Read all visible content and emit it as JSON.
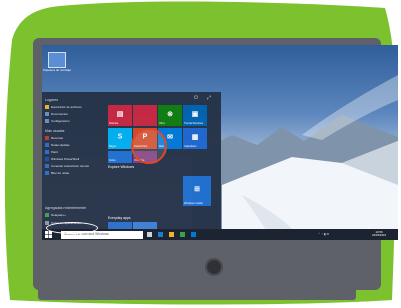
{
  "colors": {
    "blob": "#7cc22f",
    "bezel": "#5e6168",
    "start_menu": "#263348",
    "taskbar": "#1b2430",
    "highlight_ring": "#e34626"
  },
  "desktop": {
    "icon_name": "recycle-bin-icon",
    "icon_label": "Papelera de reciclaje"
  },
  "start_menu": {
    "sections": [
      {
        "heading": "Lugares",
        "items": [
          {
            "label": "Explorador de archivos",
            "icon": "folder-icon",
            "color": "#f0b429"
          },
          {
            "label": "Documentos",
            "icon": "documents-icon",
            "color": "#6b8fbf"
          },
          {
            "label": "Configuración",
            "icon": "gear-icon",
            "color": "#6b8fbf"
          }
        ]
      },
      {
        "heading": "Más usadas",
        "items": [
          {
            "label": "Recortes",
            "icon": "scissors-icon",
            "color": "#c0392b"
          },
          {
            "label": "Notas rápidas",
            "icon": "sticky-notes-icon",
            "color": "#2b6ec9"
          },
          {
            "label": "Paint",
            "icon": "paint-icon",
            "color": "#2b6ec9"
          },
          {
            "label": "Windows PowerShell",
            "icon": "powershell-icon",
            "color": "#1f4e9c"
          },
          {
            "label": "Conectar a Escritorio remoto",
            "icon": "remote-desktop-icon",
            "color": "#2b6ec9"
          },
          {
            "label": "Bloc de notas",
            "icon": "notepad-icon",
            "color": "#2b6ec9"
          }
        ]
      },
      {
        "heading": "Agregadas recientemente",
        "items": [
          {
            "label": "Notepad++",
            "icon": "notepad-plus-icon",
            "color": "#3aa14c"
          }
        ]
      }
    ],
    "all_apps": "Todas las aplicaciones",
    "explore_label": "Explore Windows",
    "everyday_label": "Everyday apps",
    "tiles": [
      {
        "label": "Noticias",
        "icon": "news-icon",
        "color": "#c7273f"
      },
      {
        "label": "Xbox",
        "icon": "xbox-icon",
        "color": "#107c10"
      },
      {
        "label": "Tienda Windows",
        "icon": "store-icon",
        "color": "#0063b1"
      },
      {
        "label": "Skype",
        "icon": "skype-icon",
        "color": "#00aff0"
      },
      {
        "label": "PowerPoint",
        "icon": "powerpoint-icon",
        "color": "#d24726"
      },
      {
        "label": "Mail",
        "icon": "mail-icon",
        "color": "#0078d7"
      },
      {
        "label": "Calendario",
        "icon": "calendar-icon",
        "color": "#1e66cf"
      },
      {
        "label": "Fotos",
        "icon": "photos-icon",
        "color": "#1f6fd1"
      },
      {
        "label": "OneNote",
        "icon": "onenote-icon",
        "color": "#80397b"
      },
      {
        "label": "Windows Insider",
        "icon": "windows-insider-icon",
        "color": "#1e6fd0"
      }
    ]
  },
  "taskbar": {
    "search_placeholder": "Search the web and Windows",
    "time": "10:56",
    "date": "24/03/2016",
    "apps": [
      "task-view-icon",
      "edge-icon",
      "file-explorer-icon",
      "store-icon",
      "mail-icon"
    ]
  }
}
